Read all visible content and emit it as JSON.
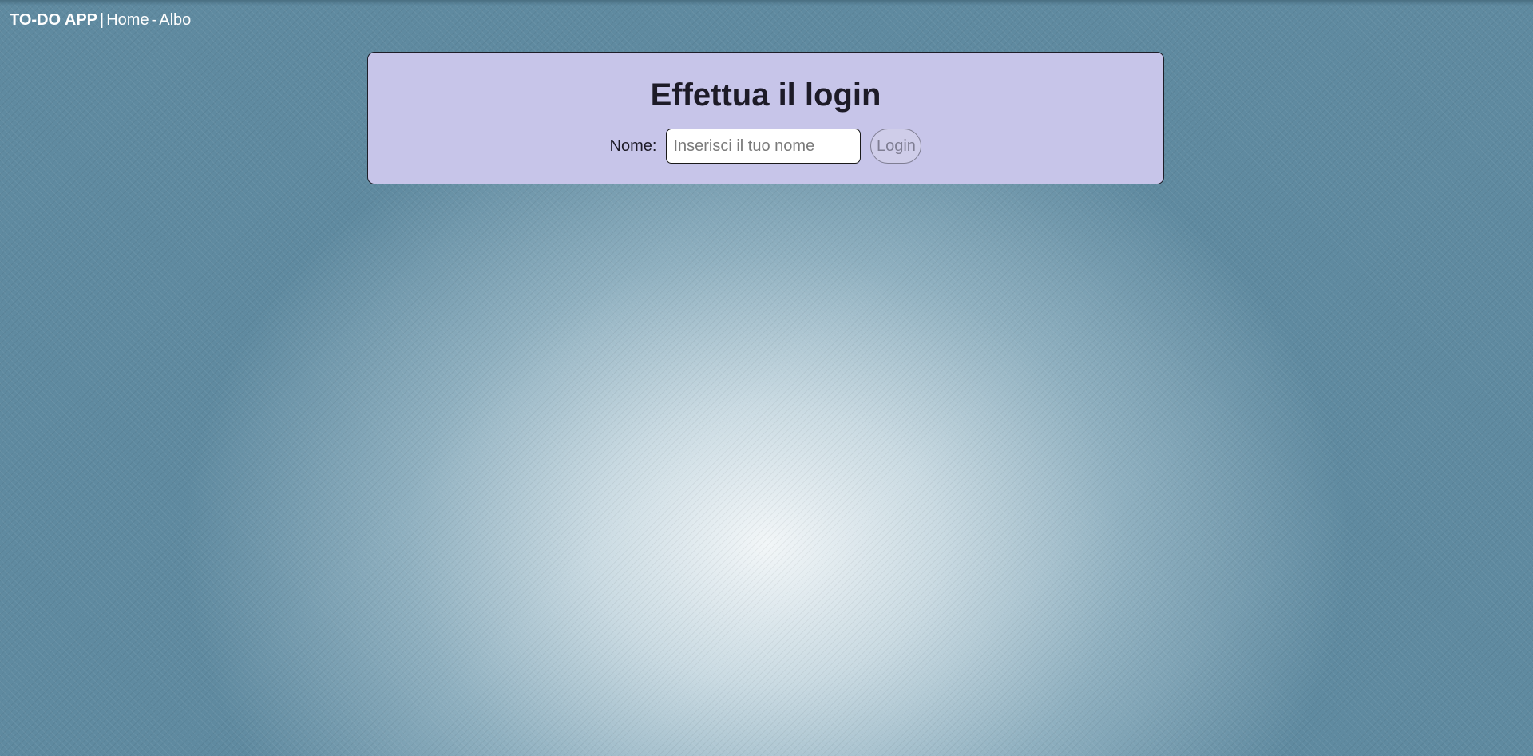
{
  "navbar": {
    "brand": "TO-DO APP",
    "separator": "|",
    "links": [
      {
        "label": "Home"
      },
      {
        "label": "Albo"
      }
    ],
    "link_separator": "-"
  },
  "login": {
    "title": "Effettua il login",
    "name_label": "Nome:",
    "name_input": {
      "value": "",
      "placeholder": "Inserisci il tuo nome"
    },
    "button_label": "Login",
    "button_disabled": true
  },
  "colors": {
    "card_background": "#c7c5e9",
    "page_background": "#5e8aa0",
    "title_text": "#1d1b27",
    "nav_text": "#ffffff"
  }
}
